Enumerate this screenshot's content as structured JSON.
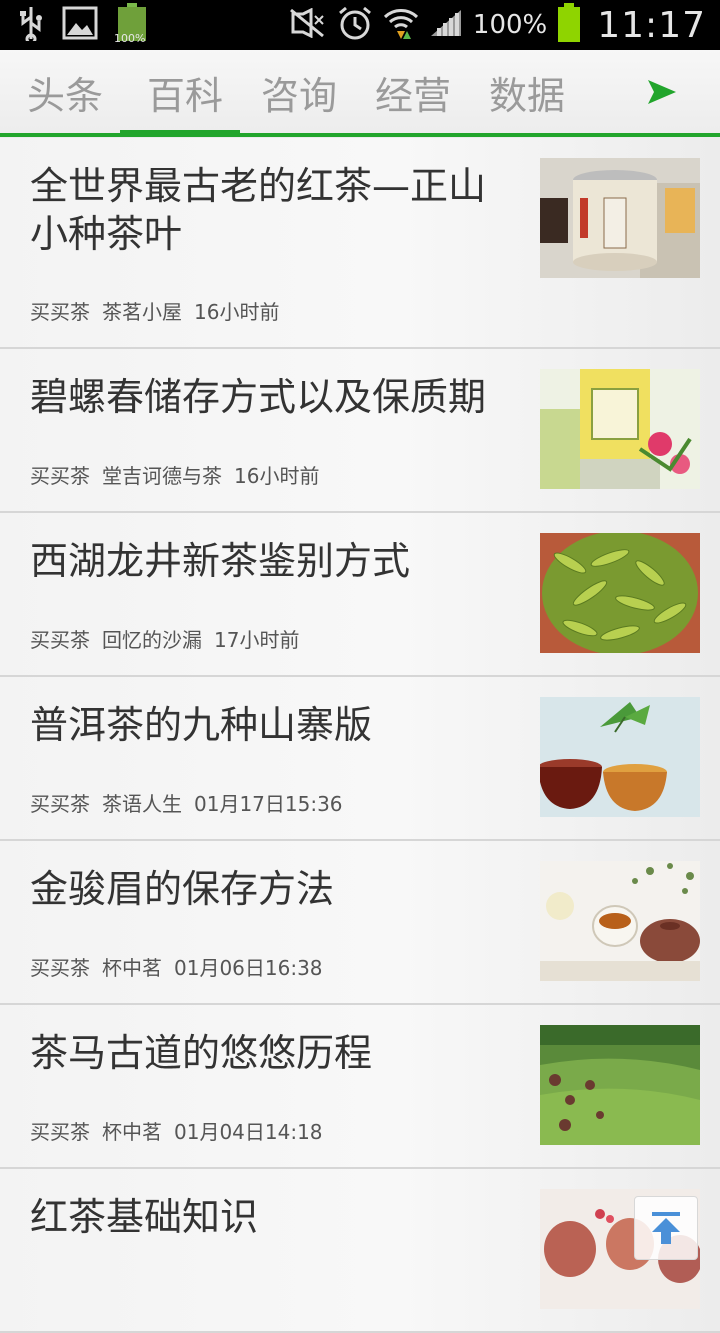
{
  "status": {
    "battery_pct": "100%",
    "battery_small": "100%",
    "time": "11:17"
  },
  "tabs": [
    {
      "label": "头条"
    },
    {
      "label": "百科"
    },
    {
      "label": "咨询"
    },
    {
      "label": "经营"
    },
    {
      "label": "数据"
    }
  ],
  "active_tab": "百科",
  "accent_color": "#22a52c",
  "articles": [
    {
      "title": "全世界最古老的红茶—正山小种茶叶",
      "source": "买买茶",
      "author": "茶茗小屋",
      "time": "16小时前",
      "thumb": "tea-canister-image"
    },
    {
      "title": "碧螺春储存方式以及保质期",
      "source": "买买茶",
      "author": "堂吉诃德与茶",
      "time": "16小时前",
      "thumb": "tea-box-flower-image"
    },
    {
      "title": "西湖龙井新茶鉴别方式",
      "source": "买买茶",
      "author": "回忆的沙漏",
      "time": "17小时前",
      "thumb": "green-tea-leaves-image"
    },
    {
      "title": "普洱茶的九种山寨版",
      "source": "买买茶",
      "author": "茶语人生",
      "time": "01月17日15:36",
      "thumb": "tea-cups-image"
    },
    {
      "title": "金骏眉的保存方法",
      "source": "买买茶",
      "author": "杯中茗",
      "time": "01月06日16:38",
      "thumb": "tea-set-image"
    },
    {
      "title": "茶马古道的悠悠历程",
      "source": "买买茶",
      "author": "杯中茗",
      "time": "01月04日14:18",
      "thumb": "tea-field-image"
    },
    {
      "title": "红茶基础知识",
      "source": "",
      "author": "",
      "time": "",
      "thumb": "black-tea-glass-image"
    }
  ]
}
